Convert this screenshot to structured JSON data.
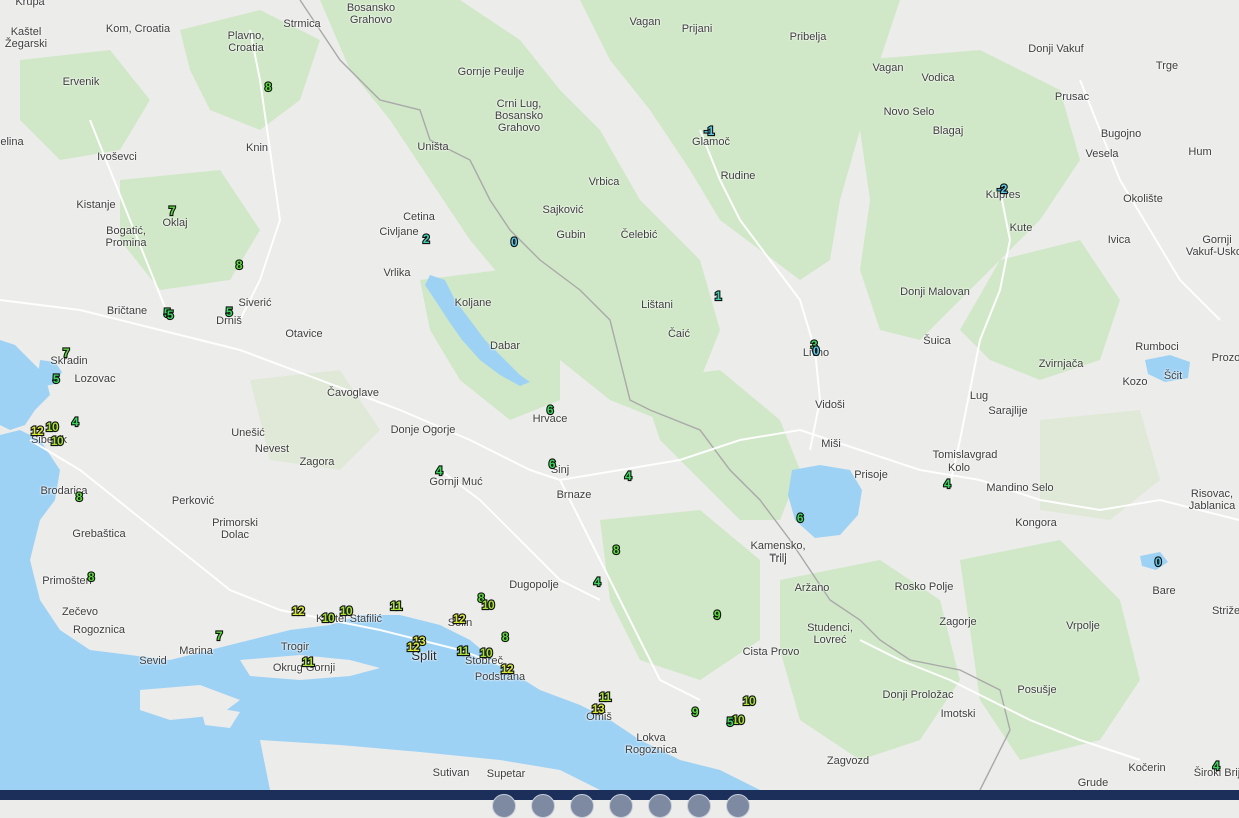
{
  "map": {
    "colors": {
      "land": "#ececea",
      "forest": "#cfe8c6",
      "water": "#9ed2f5",
      "road": "#ffffff",
      "border": "#a9a9a9"
    },
    "places": [
      {
        "label": "Krupa"
      },
      {
        "label": "Kaštel\nŽegarski"
      },
      {
        "label": "Kom, Croatia"
      },
      {
        "label": "Plavno,\nCroatia"
      },
      {
        "label": "Strmica"
      },
      {
        "label": "Bosansko\nGrahovo"
      },
      {
        "label": "Vagan"
      },
      {
        "label": "Prijani"
      },
      {
        "label": "Pribelja"
      },
      {
        "label": "Donji Vakuf"
      },
      {
        "label": "Ervenik"
      },
      {
        "label": "Gornje Peulje"
      },
      {
        "label": "Vagan"
      },
      {
        "label": "Vodica"
      },
      {
        "label": "Trge"
      },
      {
        "label": "Crni Lug,\nBosansko\nGrahovo"
      },
      {
        "label": "Novo Selo"
      },
      {
        "label": "Prusac"
      },
      {
        "label": "elina"
      },
      {
        "label": "Knin"
      },
      {
        "label": "Uništa"
      },
      {
        "label": "Glamoč"
      },
      {
        "label": "Blagaj"
      },
      {
        "label": "Bugojno"
      },
      {
        "label": "Ivoševci"
      },
      {
        "label": "Vesela"
      },
      {
        "label": "Hum"
      },
      {
        "label": "Rudine"
      },
      {
        "label": "Vrbica"
      },
      {
        "label": "Kupres"
      },
      {
        "label": "Kistanje"
      },
      {
        "label": "Oklaj"
      },
      {
        "label": "Sajković"
      },
      {
        "label": "Okolište"
      },
      {
        "label": "Cetina"
      },
      {
        "label": "Civljane"
      },
      {
        "label": "Gubin"
      },
      {
        "label": "Čelebić"
      },
      {
        "label": "Kute"
      },
      {
        "label": "Bogatić,\nPromina"
      },
      {
        "label": "Ivica"
      },
      {
        "label": "Gornji\nVakuf-Uskop"
      },
      {
        "label": "Vrlika"
      },
      {
        "label": "Donji Malovan"
      },
      {
        "label": "Siverić"
      },
      {
        "label": "Bričtane"
      },
      {
        "label": "Drniš"
      },
      {
        "label": "Koljane"
      },
      {
        "label": "Lištani"
      },
      {
        "label": "Otavice"
      },
      {
        "label": "Čaić"
      },
      {
        "label": "Šuica"
      },
      {
        "label": "Dabar"
      },
      {
        "label": "Livno"
      },
      {
        "label": "Rumboci"
      },
      {
        "label": "Skradin"
      },
      {
        "label": "Zvirnjača"
      },
      {
        "label": "Prozo"
      },
      {
        "label": "Lozovac"
      },
      {
        "label": "Šćit"
      },
      {
        "label": "Kozo"
      },
      {
        "label": "Čavoglave"
      },
      {
        "label": "Lug"
      },
      {
        "label": "Sarajlije"
      },
      {
        "label": "Vidoši"
      },
      {
        "label": "Hrvace"
      },
      {
        "label": "Šibenik"
      },
      {
        "label": "Unešić"
      },
      {
        "label": "Donje Ogorje"
      },
      {
        "label": "Miši"
      },
      {
        "label": "Nevest"
      },
      {
        "label": "Tomislavgrad"
      },
      {
        "label": "Kolo"
      },
      {
        "label": "Zagora"
      },
      {
        "label": "Sinj"
      },
      {
        "label": "Prisoje"
      },
      {
        "label": "Gornji Muć"
      },
      {
        "label": "Mandino Selo"
      },
      {
        "label": "Risovac,\nJablanica"
      },
      {
        "label": "Brodarica"
      },
      {
        "label": "Brnaze"
      },
      {
        "label": "Perković"
      },
      {
        "label": "Kongora"
      },
      {
        "label": "Grebaštica"
      },
      {
        "label": "Primorski\nDolac"
      },
      {
        "label": "Kamensko,\nTrilj"
      },
      {
        "label": "Trilj"
      },
      {
        "label": "Primošten"
      },
      {
        "label": "Dugopolje"
      },
      {
        "label": "Aržano"
      },
      {
        "label": "Rosko Polje"
      },
      {
        "label": "Bare"
      },
      {
        "label": "Striže"
      },
      {
        "label": "Zečevo"
      },
      {
        "label": "Kaštel Stafilić"
      },
      {
        "label": "Solin"
      },
      {
        "label": "Zagorje"
      },
      {
        "label": "Vrpolje"
      },
      {
        "label": "Rogoznica"
      },
      {
        "label": "Studenci,\nLovreć"
      },
      {
        "label": "Trogir"
      },
      {
        "label": "Marina"
      },
      {
        "label": "Split"
      },
      {
        "label": "Stobreč"
      },
      {
        "label": "Cista Provo"
      },
      {
        "label": "Sevid"
      },
      {
        "label": "Okrug Gornji"
      },
      {
        "label": "Podstrana"
      },
      {
        "label": "Posušje"
      },
      {
        "label": "Donji Proložac"
      },
      {
        "label": "Omiš"
      },
      {
        "label": "Imotski"
      },
      {
        "label": "Lokva\nRogoznica"
      },
      {
        "label": "Zagvozd"
      },
      {
        "label": "Sutivan"
      },
      {
        "label": "Supetar"
      },
      {
        "label": "Kočerin"
      },
      {
        "label": "Široki Brije"
      },
      {
        "label": "Grude"
      }
    ],
    "temperature_markers": [
      {
        "value": "8"
      },
      {
        "value": "-1"
      },
      {
        "value": "-2"
      },
      {
        "value": "7"
      },
      {
        "value": "2"
      },
      {
        "value": "0"
      },
      {
        "value": "8"
      },
      {
        "value": "1"
      },
      {
        "value": "5"
      },
      {
        "value": "5"
      },
      {
        "value": "3"
      },
      {
        "value": "0"
      },
      {
        "value": "7"
      },
      {
        "value": "5"
      },
      {
        "value": "5"
      },
      {
        "value": "4"
      },
      {
        "value": "12"
      },
      {
        "value": "10"
      },
      {
        "value": "10"
      },
      {
        "value": "6"
      },
      {
        "value": "6"
      },
      {
        "value": "4"
      },
      {
        "value": "4"
      },
      {
        "value": "4"
      },
      {
        "value": "8"
      },
      {
        "value": "6"
      },
      {
        "value": "8"
      },
      {
        "value": "4"
      },
      {
        "value": "0"
      },
      {
        "value": "8"
      },
      {
        "value": "9"
      },
      {
        "value": "8"
      },
      {
        "value": "10"
      },
      {
        "value": "12"
      },
      {
        "value": "10"
      },
      {
        "value": "10"
      },
      {
        "value": "11"
      },
      {
        "value": "12"
      },
      {
        "value": "7"
      },
      {
        "value": "8"
      },
      {
        "value": "13"
      },
      {
        "value": "12"
      },
      {
        "value": "11"
      },
      {
        "value": "10"
      },
      {
        "value": "11"
      },
      {
        "value": "12"
      },
      {
        "value": "11"
      },
      {
        "value": "13"
      },
      {
        "value": "9"
      },
      {
        "value": "10"
      },
      {
        "value": "10"
      },
      {
        "value": "5"
      },
      {
        "value": "4"
      }
    ]
  },
  "bottom_bar": {
    "buttons": [
      "zoom-out-icon",
      "zoom-in-icon",
      "layers-icon",
      "locate-icon",
      "play-icon",
      "settings-icon",
      "info-icon"
    ]
  }
}
